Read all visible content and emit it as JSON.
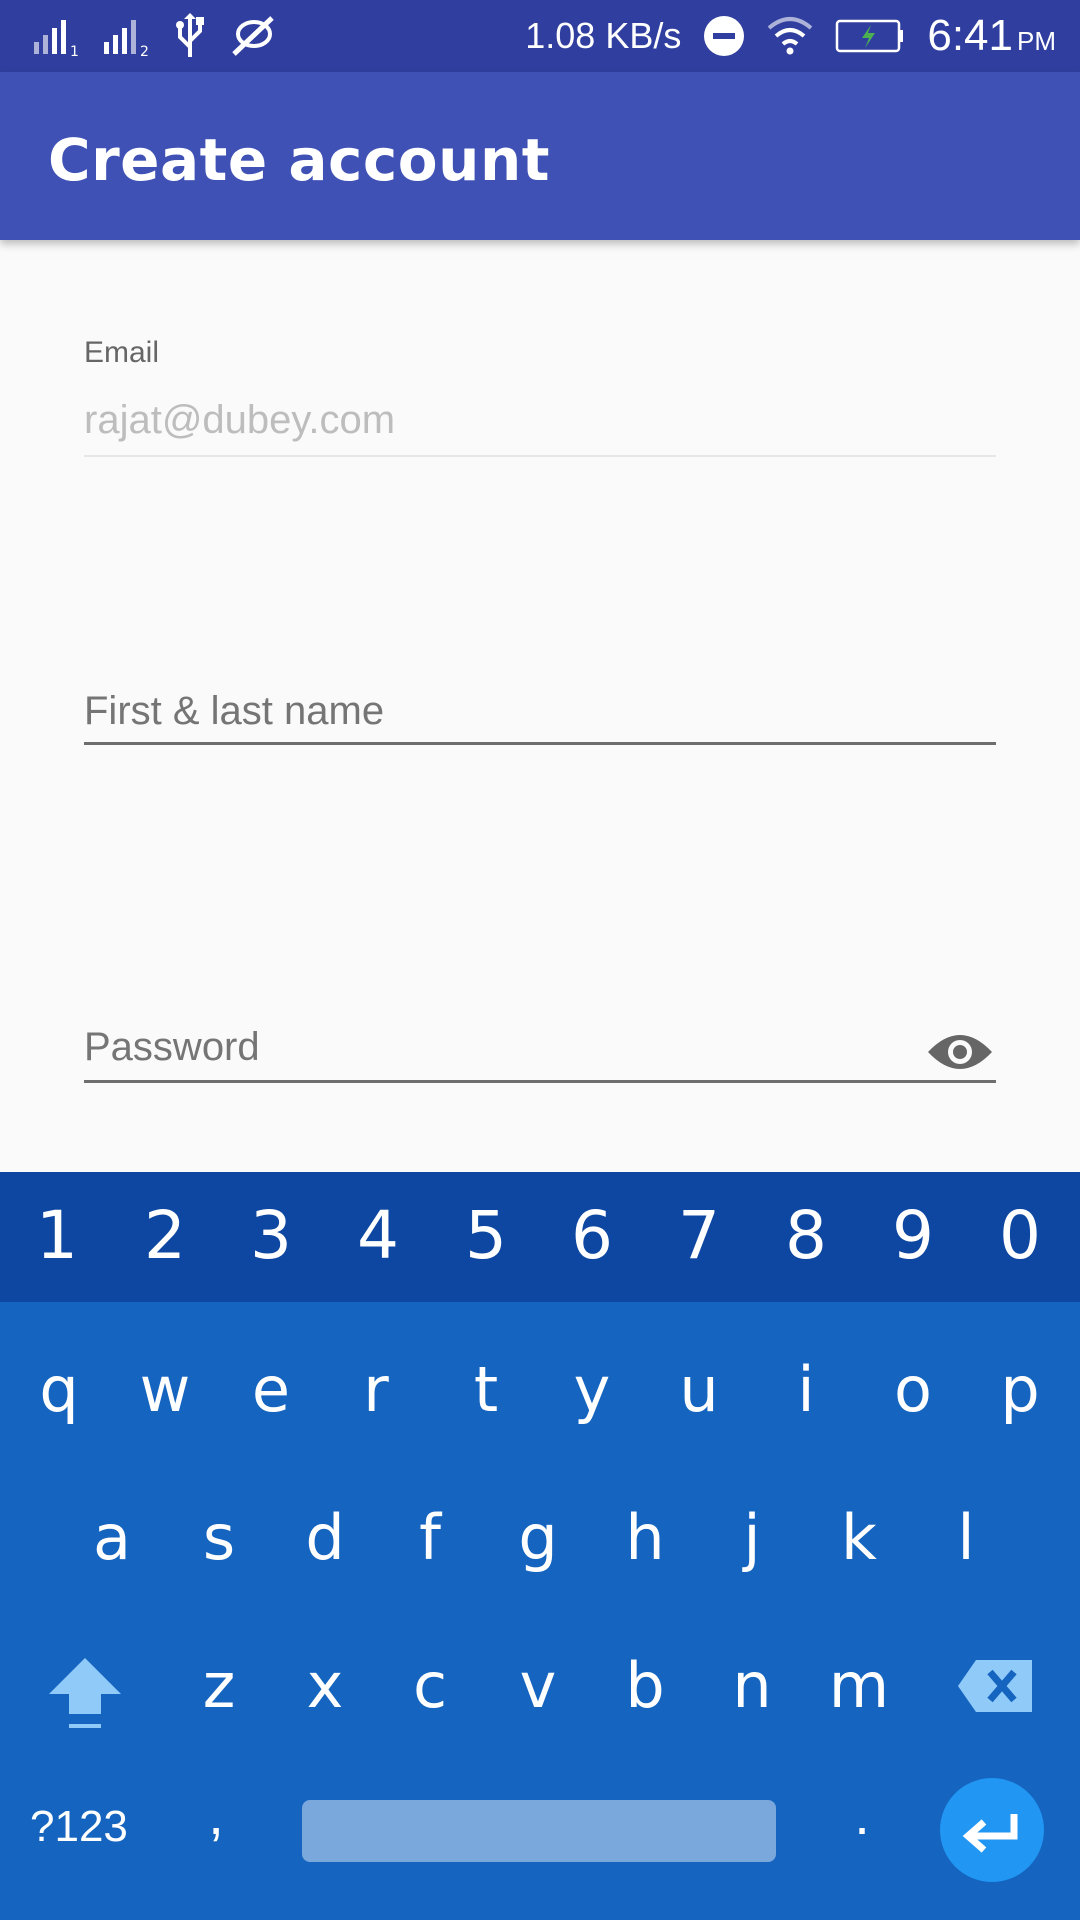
{
  "status_bar": {
    "network_speed": "1.08 KB/s",
    "time": "6:41",
    "ampm": "PM",
    "icons": [
      "signal-sim1-icon",
      "signal-sim2-icon",
      "usb-icon",
      "notifications-off-icon",
      "do-not-disturb-icon",
      "wifi-icon",
      "battery-charging-icon"
    ]
  },
  "app_bar": {
    "title": "Create account"
  },
  "form": {
    "email_label": "Email",
    "email_value": "rajat@dubey.com",
    "name_placeholder": "First & last name",
    "password_placeholder": "Password"
  },
  "keyboard": {
    "number_row": [
      "1",
      "2",
      "3",
      "4",
      "5",
      "6",
      "7",
      "8",
      "9",
      "0"
    ],
    "row1": [
      "q",
      "w",
      "e",
      "r",
      "t",
      "y",
      "u",
      "i",
      "o",
      "p"
    ],
    "row2": [
      "a",
      "s",
      "d",
      "f",
      "g",
      "h",
      "j",
      "k",
      "l"
    ],
    "row3": [
      "z",
      "x",
      "c",
      "v",
      "b",
      "n",
      "m"
    ],
    "symbols_label": "?123",
    "comma": ",",
    "period": "."
  },
  "colors": {
    "status_bar": "#303f9f",
    "app_bar": "#3f51b5",
    "keyboard_bg": "#1565c0",
    "number_row_bg": "#0d47a1",
    "enter_key": "#2196f3"
  }
}
